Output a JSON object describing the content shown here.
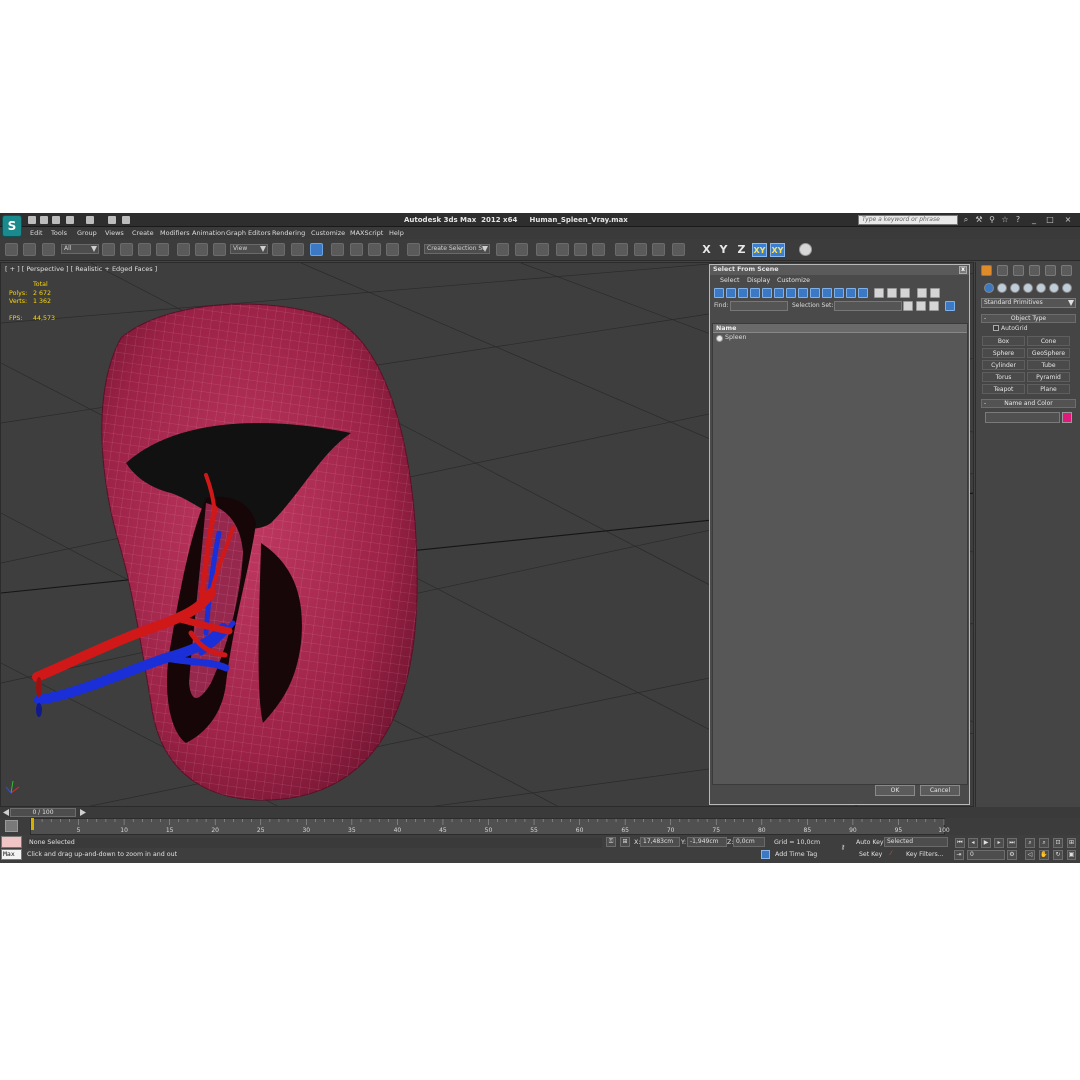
{
  "window": {
    "logo": "S",
    "title": "Autodesk 3ds Max  2012 x64     Human_Spleen_Vray.max",
    "search_placeholder": "Type a keyword or phrase"
  },
  "menu": [
    "Edit",
    "Tools",
    "Group",
    "Views",
    "Create",
    "Modifiers",
    "Animation",
    "Graph Editors",
    "Rendering",
    "Customize",
    "MAXScript",
    "Help"
  ],
  "toolbar": {
    "filter_value": "All",
    "refcoord_value": "View",
    "selection_set_value": "Create Selection Se",
    "axes": [
      "X",
      "Y",
      "Z",
      "XY",
      "XY"
    ]
  },
  "viewport": {
    "label": "[ + ] [ Perspective ] [ Realistic + Edged Faces ]",
    "stats": {
      "header": "Total",
      "polys_label": "Polys:",
      "polys_value": "2 672",
      "verts_label": "Verts:",
      "verts_value": "1 362",
      "fps_label": "FPS:",
      "fps_value": "44,573"
    }
  },
  "dialog": {
    "title": "Select From Scene",
    "close": "x",
    "menu": [
      "Select",
      "Display",
      "Customize"
    ],
    "find_label": "Find:",
    "selection_set_label": "Selection Set:",
    "column_name": "Name",
    "objects": [
      "Spleen"
    ],
    "ok": "OK",
    "cancel": "Cancel"
  },
  "command_panel": {
    "category": "Standard Primitives",
    "object_type_title": "Object Type",
    "autogrid_label": "AutoGrid",
    "primitives": [
      "Box",
      "Cone",
      "Sphere",
      "GeoSphere",
      "Cylinder",
      "Tube",
      "Torus",
      "Pyramid",
      "Teapot",
      "Plane"
    ],
    "name_color_title": "Name and Color",
    "rollout_toggle": "-",
    "object_color": "#e0197c"
  },
  "timeline": {
    "slider_text": "0 / 100",
    "ticks": [
      "0",
      "5",
      "10",
      "15",
      "20",
      "25",
      "30",
      "35",
      "40",
      "45",
      "50",
      "55",
      "60",
      "65",
      "70",
      "75",
      "80",
      "85",
      "90",
      "95",
      "100"
    ]
  },
  "status": {
    "maxscript_label": "Max",
    "selection": "None Selected",
    "prompt": "Click and drag up-and-down to zoom in and out",
    "x_label": "X:",
    "x_value": "17,483cm",
    "y_label": "Y:",
    "y_value": "-1,949cm",
    "z_label": "Z:",
    "z_value": "0,0cm",
    "grid": "Grid = 10,0cm",
    "add_time_tag": "Add Time Tag",
    "auto_key": "Auto Key",
    "set_key": "Set Key",
    "selected_value": "Selected",
    "key_filters": "Key Filters...",
    "current_frame": "0"
  },
  "colors": {
    "spleen": "#b02a55",
    "artery": "#d01818",
    "vein": "#1a2fd8",
    "accent": "#3b79c4"
  }
}
